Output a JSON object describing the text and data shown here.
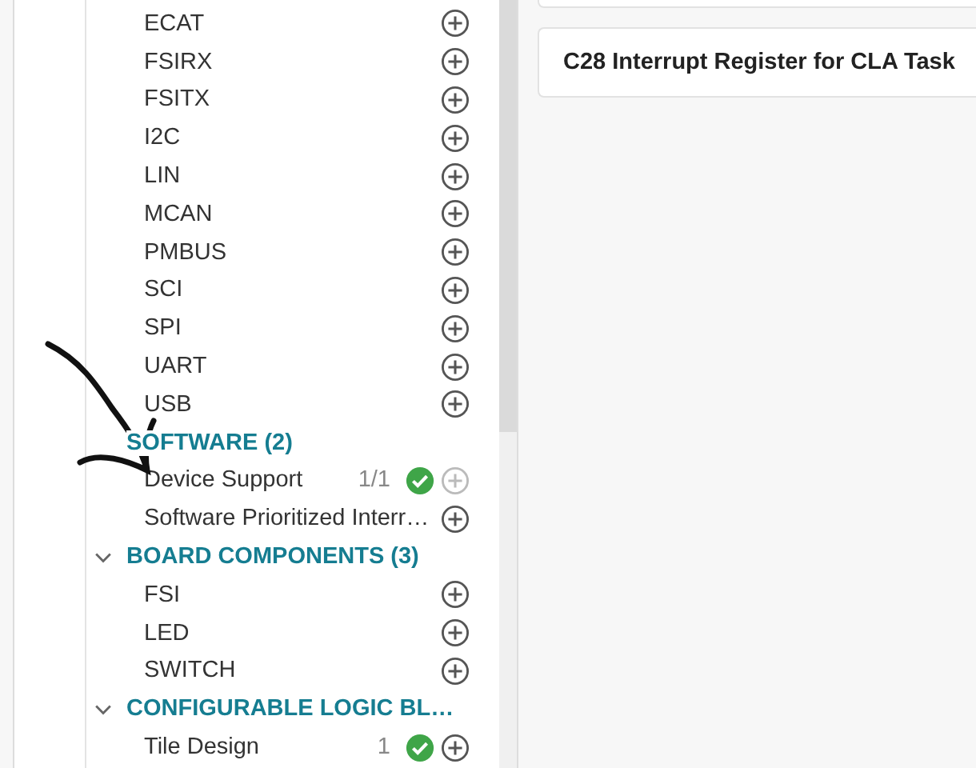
{
  "tree": [
    {
      "kind": "item",
      "label": "ECAT",
      "add_disabled": false
    },
    {
      "kind": "item",
      "label": "FSIRX",
      "add_disabled": false
    },
    {
      "kind": "item",
      "label": "FSITX",
      "add_disabled": false
    },
    {
      "kind": "item",
      "label": "I2C",
      "add_disabled": false
    },
    {
      "kind": "item",
      "label": "LIN",
      "add_disabled": false
    },
    {
      "kind": "item",
      "label": "MCAN",
      "add_disabled": false
    },
    {
      "kind": "item",
      "label": "PMBUS",
      "add_disabled": false
    },
    {
      "kind": "item",
      "label": "SCI",
      "add_disabled": false
    },
    {
      "kind": "item",
      "label": "SPI",
      "add_disabled": false
    },
    {
      "kind": "item",
      "label": "UART",
      "add_disabled": false
    },
    {
      "kind": "item",
      "label": "USB",
      "add_disabled": false
    },
    {
      "kind": "section",
      "label": "SOFTWARE (2)",
      "children": [
        {
          "label": "Device Support",
          "count": "1/1",
          "added": true,
          "add_disabled": true
        },
        {
          "label": "Software Prioritized Interr…",
          "added": false,
          "add_disabled": false
        }
      ]
    },
    {
      "kind": "section",
      "label": "BOARD COMPONENTS (3)",
      "expanded": true,
      "children": [
        {
          "label": "FSI",
          "added": false,
          "add_disabled": false
        },
        {
          "label": "LED",
          "added": false,
          "add_disabled": false
        },
        {
          "label": "SWITCH",
          "added": false,
          "add_disabled": false
        }
      ]
    },
    {
      "kind": "section",
      "label": "CONFIGURABLE LOGIC BL…",
      "expanded": true,
      "children": [
        {
          "label": "Tile Design",
          "count": "1",
          "added": true,
          "add_disabled": false
        }
      ]
    }
  ],
  "card": {
    "title": "C28 Interrupt Register for CLA Task"
  }
}
